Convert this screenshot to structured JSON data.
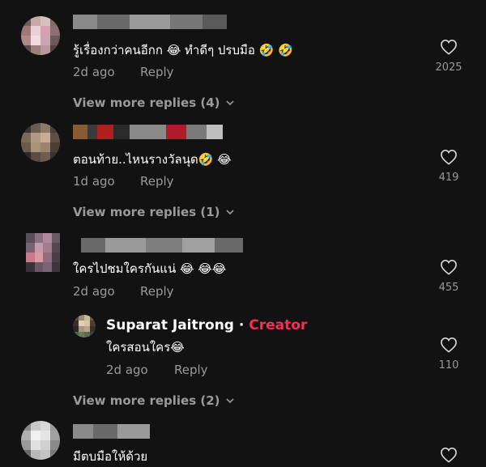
{
  "comments": [
    {
      "text": "รู้เรื่องกว่าคนอีกก 😂  ทำดีๆ ปรบมือ 🤣 🤣",
      "time": "2d ago",
      "reply": "Reply",
      "likes": "2025",
      "view_more": "View more replies (4)"
    },
    {
      "text": "ตอนท้าย..ไหนรางวัลนุด🤣 😂",
      "time": "1d ago",
      "reply": "Reply",
      "likes": "419",
      "view_more": "View more replies (1)"
    },
    {
      "text": "ใครไปชมใครกันแน่ 😂 😂😂",
      "time": "2d ago",
      "reply": "Reply",
      "likes": "455"
    },
    {
      "creator_name": "Suparat Jaitrong",
      "separator": "·",
      "creator_tag": "Creator",
      "text": "ใครสอนใคร😂",
      "time": "2d ago",
      "reply": "Reply",
      "likes": "110",
      "view_more": "View more replies (2)"
    },
    {
      "text": "มีตบมือให้ด้วย"
    }
  ],
  "colors": {
    "creator": "#fe2c55",
    "muted": "#9a9a9a",
    "background": "#121212"
  },
  "icons": {
    "like": "heart-outline-icon",
    "expand": "chevron-down-icon"
  }
}
